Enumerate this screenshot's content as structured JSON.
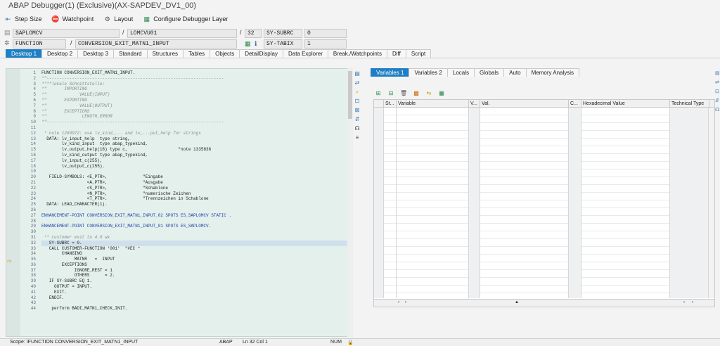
{
  "title": "ABAP Debugger(1)  (Exclusive)(AX-SAPDEV_DV1_00)",
  "toolbar": [
    {
      "icon": "step-size-icon",
      "label": "Step Size"
    },
    {
      "icon": "watchpoint-icon",
      "label": "Watchpoint"
    },
    {
      "icon": "layout-icon",
      "label": "Layout"
    },
    {
      "icon": "configure-icon",
      "label": "Configure Debugger Layer"
    }
  ],
  "info": {
    "program": "SAPLOMCV",
    "include": "LOMCVU01",
    "line": "32",
    "var1_name": "SY-SUBRC",
    "var1_value": "0",
    "type": "FUNCTION",
    "function": "CONVERSION_EXIT_MATN1_INPUT",
    "var2_name": "SY-TABIX",
    "var2_value": "1"
  },
  "tabs": [
    "Desktop 1",
    "Desktop 2",
    "Desktop 3",
    "Standard",
    "Structures",
    "Tables",
    "Objects",
    "DetailDisplay",
    "Data Explorer",
    "Break./Watchpoints",
    "Diff",
    "Script"
  ],
  "active_tab": "Desktop 1",
  "code": {
    "lines": [
      "1",
      "2",
      "3",
      "4",
      "5",
      "6",
      "7",
      "8",
      "9",
      "10",
      "11",
      "12",
      "13",
      "14",
      "15",
      "16",
      "17",
      "18",
      "19",
      "20",
      "21",
      "22",
      "23",
      "24",
      "25",
      "26",
      "27",
      "28",
      "29",
      "30",
      "31",
      "32",
      "33",
      "34",
      "35",
      "36",
      "37",
      "38",
      "39",
      "40",
      "41",
      "42",
      "43",
      "44"
    ],
    "text": [
      "FUNCTION CONVERSION_EXIT_MATN1_INPUT.",
      "*\"----------------------------------------------------------------------",
      "*\"*\"lokale Schnittstelle:",
      "*\"       IMPORTING",
      "*\"             VALUE(INPUT)",
      "*\"       EXPORTING",
      "*\"             VALUE(OUTPUT)",
      "*\"       EXCEPTIONS",
      "*\"              LENGTH_ERROR",
      "*\"----------------------------------------------------------------------",
      "",
      " * note 1260972: use lv_kind_... and lv_...put_help for strings",
      "  DATA: lv_input_help  type string,",
      "        lv_kind_input  type abap_typekind,",
      "        lv_output_help(18) type c,                    \"note 1335836",
      "        lv_kind_output type abap_typekind,",
      "        lv_input_c(255),",
      "        lv_output_c(255).",
      "",
      "   FIELD-SYMBOLS: <E_PTR>,              \"Eingabe",
      "                  <A_PTR>,              \"Ausgabe",
      "                  <S_PTR>,              \"Schablone",
      "                  <N_PTR>,              \"numerische Zeichen",
      "                  <T_PTR>.              \"Trennzeichen in Schablone",
      "  DATA: LEAD_CHARACTER(1).",
      "",
      "ENHANCEMENT-POINT CONVERSION_EXIT_MATN1_INPUT_02 SPOTS ES_SAPLOMCV STATIC .",
      "",
      "ENHANCEMENT-POINT CONVERSION_EXIT_MATN1_INPUT_01 SPOTS ES_SAPLOMCV.",
      "",
      " ** customer exit to 4.0 wk",
      "   SY-SUBRC = 0.",
      "   CALL CUSTOMER-FUNCTION '001'  \"#EC *",
      "        CHANGING",
      "             MATNR   =  INPUT",
      "        EXCEPTIONS",
      "             IGNORE_REST = 1",
      "             OTHERS      = 2.",
      "   IF SY-SUBRC EQ 1.",
      "     OUTPUT = INPUT.",
      "     EXIT.",
      "   ENDIF.",
      "",
      "    perform BADI_MATN1_CHECK_INIT."
    ]
  },
  "right_tabs": [
    "Variables 1",
    "Variables 2",
    "Locals",
    "Globals",
    "Auto",
    "Memory Analysis"
  ],
  "active_right_tab": "Variables 1",
  "grid_headers": [
    "St...",
    "Variable",
    "V...",
    "Val.",
    "C...",
    "Hexadecimal Value",
    "Technical Type"
  ],
  "status": {
    "scope": "Scope: \\FUNCTION CONVERSION_EXIT_MATN1_INPUT",
    "lang": "ABAP",
    "position": "Ln  32 Col   1",
    "num": "NUM"
  }
}
